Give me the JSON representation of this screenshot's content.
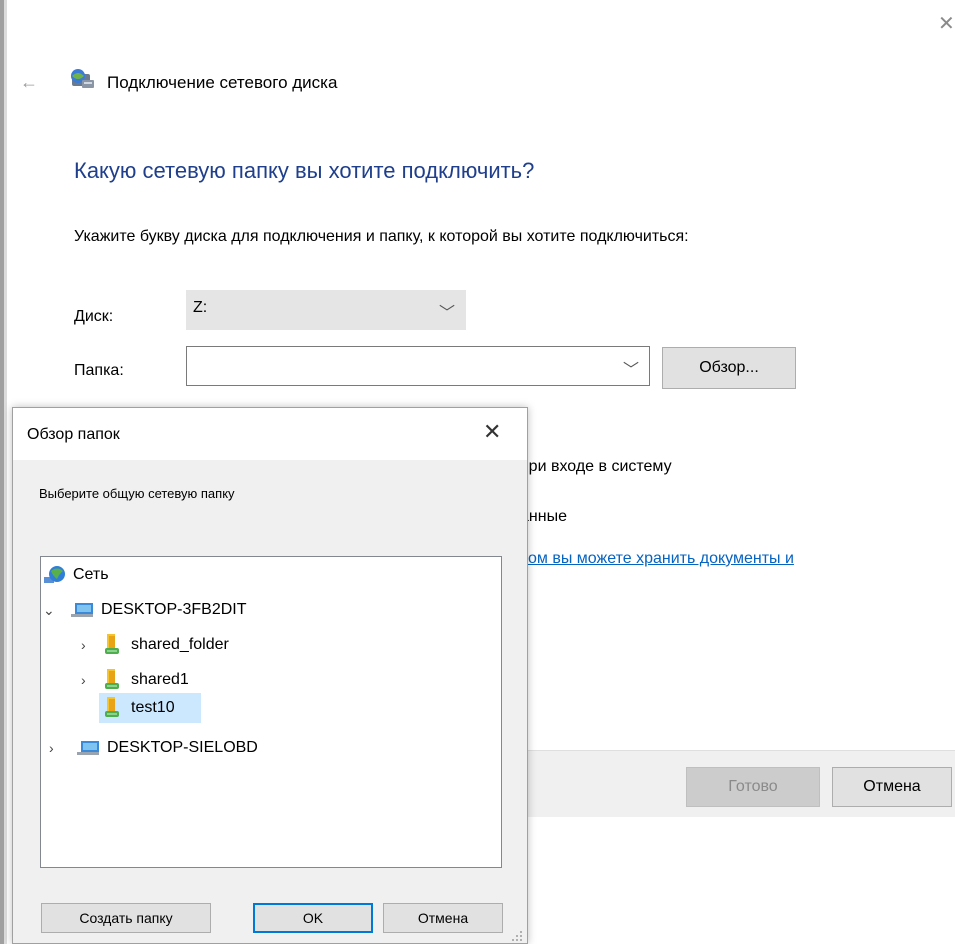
{
  "wizard": {
    "title": "Подключение сетевого диска",
    "heading": "Какую сетевую папку вы хотите подключить?",
    "instruction": "Укажите букву диска для подключения и папку, к которой вы хотите подключиться:",
    "drive_label": "Диск:",
    "drive_value": "Z:",
    "folder_label": "Папка:",
    "folder_value": "",
    "browse_label": "Обзор...",
    "reconnect_text_partial": "при входе в систему",
    "credentials_text_partial": "анные",
    "link_text_partial": "ом вы можете хранить документы и",
    "done_label": "Готово",
    "cancel_label": "Отмена"
  },
  "dialog": {
    "title": "Обзор папок",
    "prompt": "Выберите общую сетевую папку",
    "tree": [
      {
        "label": "Сеть",
        "icon": "network-icon"
      },
      {
        "label": "DESKTOP-3FB2DIT",
        "icon": "computer-icon",
        "expanded": true
      },
      {
        "label": "shared_folder",
        "icon": "shared-folder-icon"
      },
      {
        "label": "shared1",
        "icon": "shared-folder-icon"
      },
      {
        "label": "test10",
        "icon": "shared-folder-icon",
        "selected": true
      },
      {
        "label": "DESKTOP-SIELOBD",
        "icon": "computer-icon"
      }
    ],
    "new_folder_label": "Создать папку",
    "ok_label": "OK",
    "cancel_label": "Отмена"
  },
  "colors": {
    "heading": "#1f3f8c",
    "link": "#0563c1",
    "selection": "#cce8ff",
    "accent": "#0078d7"
  }
}
